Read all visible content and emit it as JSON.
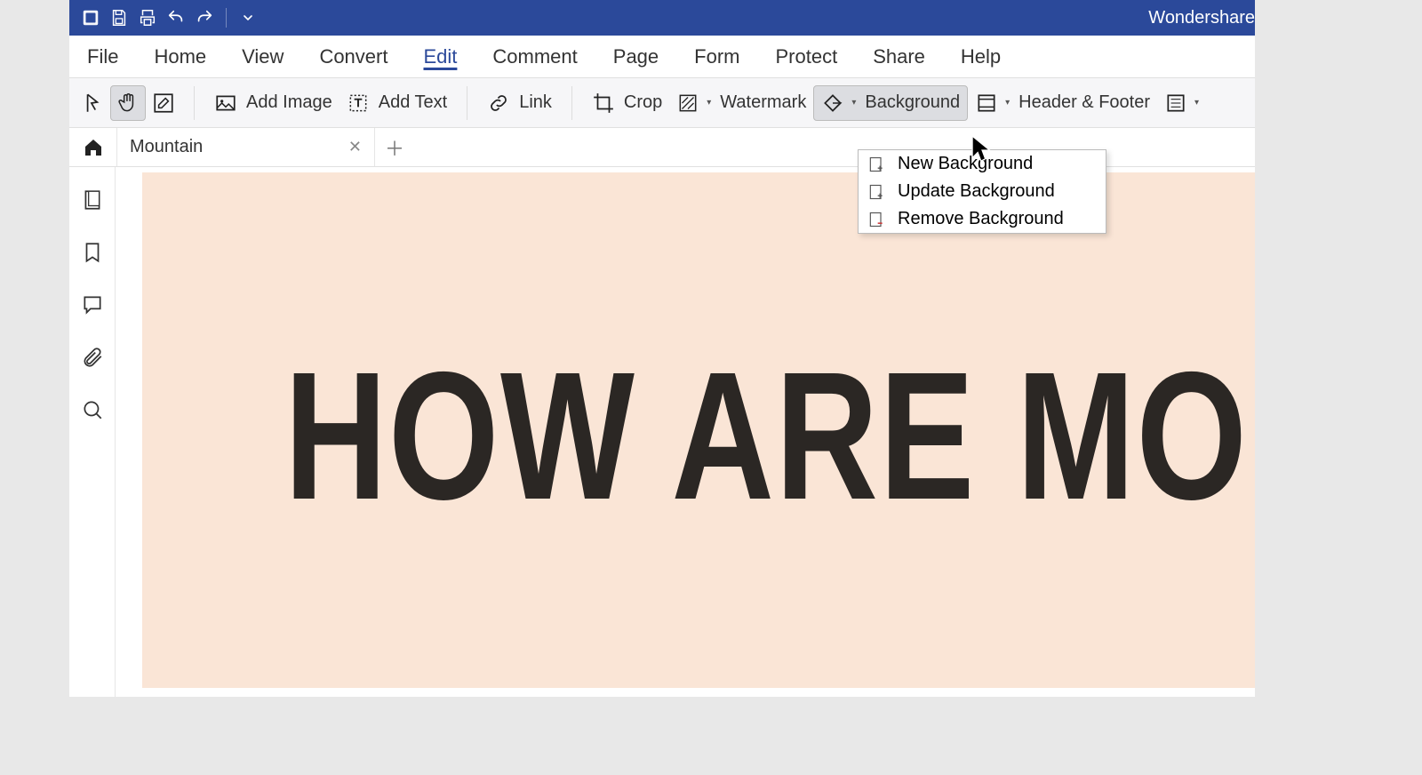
{
  "brand": "Wondershare",
  "menus": {
    "file": "File",
    "home": "Home",
    "view": "View",
    "convert": "Convert",
    "edit": "Edit",
    "comment": "Comment",
    "page": "Page",
    "form": "Form",
    "protect": "Protect",
    "share": "Share",
    "help": "Help"
  },
  "toolbar": {
    "addImage": "Add Image",
    "addText": "Add Text",
    "link": "Link",
    "crop": "Crop",
    "watermark": "Watermark",
    "background": "Background",
    "headerFooter": "Header & Footer"
  },
  "tabs": {
    "doc1": "Mountain"
  },
  "backgroundMenu": {
    "new": "New Background",
    "update": "Update Background",
    "remove": "Remove Background"
  },
  "document": {
    "headline": "HOW ARE MOUN"
  }
}
